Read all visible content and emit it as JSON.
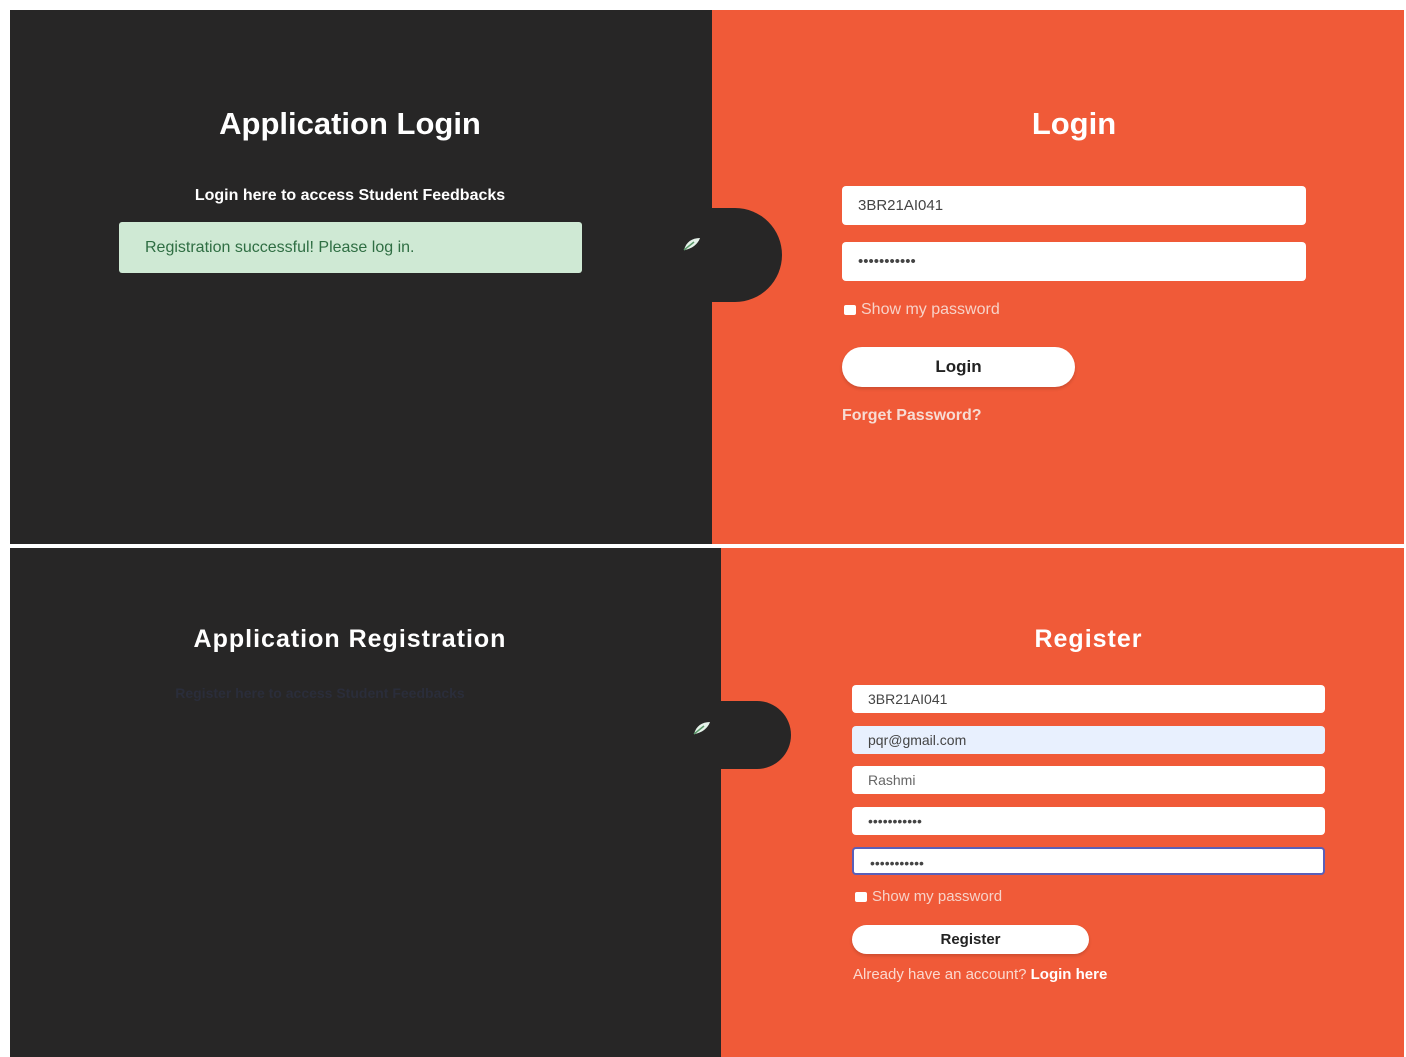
{
  "login_screen": {
    "left_title": "Application Login",
    "left_subtitle": "Login here to access Student Feedbacks",
    "alert_message": "Registration successful! Please log in.",
    "right_title": "Login",
    "usn_value": "3BR21AI041",
    "password_value": "•••••••••••",
    "show_password_label": "Show my password",
    "login_button_label": "Login",
    "forget_password_link": "Forget Password?"
  },
  "register_screen": {
    "left_title": "Application Registration",
    "left_subtitle": "Register here to access Student Feedbacks",
    "right_title": "Register",
    "usn_value": "3BR21AI041",
    "email_value": "pqr@gmail.com",
    "name_value": "Rashmi",
    "password_value": "•••••••••••",
    "confirm_password_value": "•••••••••••",
    "show_password_label": "Show my password",
    "register_button_label": "Register",
    "already_text": "Already have an account?",
    "login_here_link": "Login here"
  },
  "colors": {
    "dark_panel": "#272626",
    "accent_panel": "#f05a38",
    "alert_bg": "#cfe9d4"
  }
}
